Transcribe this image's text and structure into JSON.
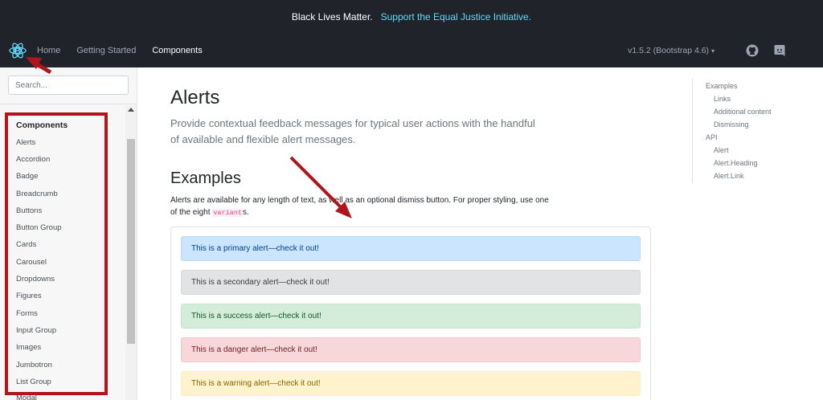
{
  "banner": {
    "text": "Black Lives Matter.",
    "link": "Support the Equal Justice Initiative."
  },
  "navbar": {
    "brand_icon": "react-bootstrap-logo-icon",
    "links": [
      "Home",
      "Getting Started",
      "Components"
    ],
    "active": "Components",
    "version": "v1.5.2 (Bootstrap 4.6)",
    "icons": [
      "github-icon",
      "discord-icon"
    ]
  },
  "sidebar": {
    "search_placeholder": "Search...",
    "title": "Components",
    "items": [
      "Alerts",
      "Accordion",
      "Badge",
      "Breadcrumb",
      "Buttons",
      "Button Group",
      "Cards",
      "Carousel",
      "Dropdowns",
      "Figures",
      "Forms",
      "Input Group",
      "Images",
      "Jumbotron",
      "List Group",
      "Modal"
    ]
  },
  "main": {
    "title": "Alerts",
    "lead": "Provide contextual feedback messages for typical user actions with the handful of available and flexible alert messages.",
    "section_title": "Examples",
    "desc_before": "Alerts are available for any length of text, as well as an optional dismiss button. For proper styling, use one of the eight ",
    "desc_code": "variant",
    "desc_after": "s.",
    "alerts": [
      {
        "text": "This is a primary alert—check it out!",
        "bg": "#cce5ff",
        "border": "#b8daff",
        "color": "#004085"
      },
      {
        "text": "This is a secondary alert—check it out!",
        "bg": "#e2e3e5",
        "border": "#d6d8db",
        "color": "#383d41"
      },
      {
        "text": "This is a success alert—check it out!",
        "bg": "#d4edda",
        "border": "#c3e6cb",
        "color": "#155724"
      },
      {
        "text": "This is a danger alert—check it out!",
        "bg": "#f8d7da",
        "border": "#f5c6cb",
        "color": "#721c24"
      },
      {
        "text": "This is a warning alert—check it out!",
        "bg": "#fff3cd",
        "border": "#ffeeba",
        "color": "#856404"
      }
    ]
  },
  "toc": {
    "items": [
      "Examples",
      "Links",
      "Additional content",
      "Dismissing",
      "API",
      "Alert",
      "Alert.Heading",
      "Alert.Link"
    ]
  },
  "colors": {
    "navbar_bg": "#20232a",
    "accent": "#61dafb",
    "annotation_red": "#b0151c"
  }
}
